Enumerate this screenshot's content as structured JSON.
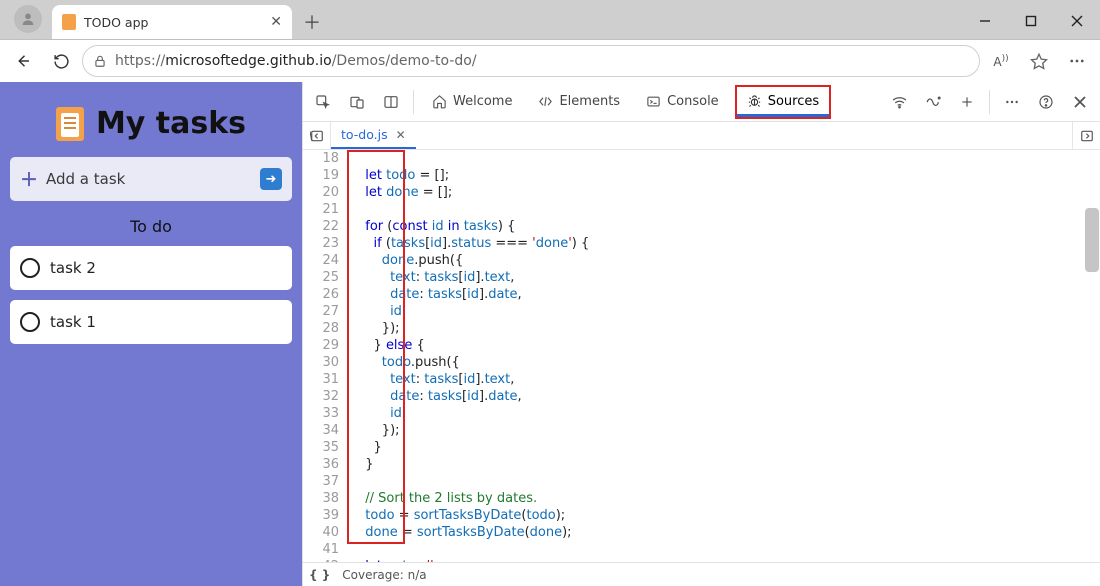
{
  "browser": {
    "tab_title": "TODO app",
    "url_prefix": "https://",
    "url_host": "microsoftedge.github.io",
    "url_path": "/Demos/demo-to-do/"
  },
  "app": {
    "title": "My tasks",
    "add_placeholder": "Add a task",
    "section_todo": "To do",
    "tasks": [
      "task 2",
      "task 1"
    ]
  },
  "devtools": {
    "tabs": {
      "welcome": "Welcome",
      "elements": "Elements",
      "console": "Console",
      "sources": "Sources"
    },
    "active_tab": "sources",
    "file_tab": "to-do.js",
    "status_coverage": "Coverage: n/a",
    "code_first_line": 18,
    "code_lines": [
      "",
      "  let todo = [];",
      "  let done = [];",
      "",
      "  for (const id in tasks) {",
      "    if (tasks[id].status === 'done') {",
      "      done.push({",
      "        text: tasks[id].text,",
      "        date: tasks[id].date,",
      "        id",
      "      });",
      "    } else {",
      "      todo.push({",
      "        text: tasks[id].text,",
      "        date: tasks[id].date,",
      "        id",
      "      });",
      "    }",
      "  }",
      "",
      "  // Sort the 2 lists by dates.",
      "  todo = sortTasksByDate(todo);",
      "  done = sortTasksByDate(done);",
      "",
      "  let out = '';",
      ""
    ]
  },
  "highlights": {
    "sources_tab": true,
    "gutter_region": true
  }
}
